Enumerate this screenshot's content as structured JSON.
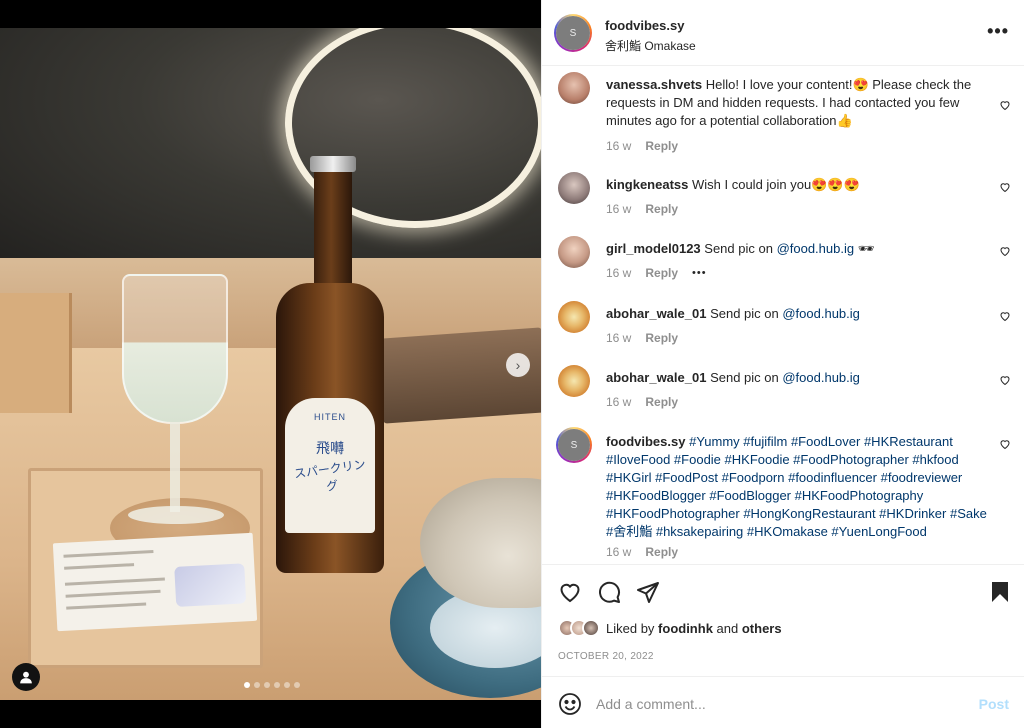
{
  "post": {
    "username": "foodvibes.sy",
    "location": "舍利鮨 Omakase",
    "avatar_text": "S"
  },
  "media": {
    "label_brand": "HITEN",
    "label_line1": "飛囀",
    "label_line2": "スパークリング",
    "carousel": {
      "count": 6,
      "active_index": 0
    }
  },
  "comments": [
    {
      "username": "vanessa.shvets",
      "text": "Hello! I love your content!😍 Please check the requests in DM and hidden requests. I had contacted you few minutes ago for a potential collaboration👍",
      "time": "16 w",
      "reply": "Reply"
    },
    {
      "username": "kingkeneatss",
      "text": "Wish I could join you😍😍😍",
      "time": "16 w",
      "reply": "Reply"
    },
    {
      "username": "girl_model0123",
      "text_before": "Send pic on ",
      "mention": "@food.hub.ig",
      "text_after": " 🕶",
      "time": "16 w",
      "reply": "Reply",
      "more": "•••"
    },
    {
      "username": "abohar_wale_01",
      "text_before": "Send pic on ",
      "mention": "@food.hub.ig",
      "time": "16 w",
      "reply": "Reply"
    },
    {
      "username": "abohar_wale_01",
      "text_before": "Send pic on ",
      "mention": "@food.hub.ig",
      "time": "16 w",
      "reply": "Reply"
    },
    {
      "username": "foodvibes.sy",
      "hashtags": "#Yummy #fujifilm #FoodLover #HKRestaurant #IloveFood #Foodie #HKFoodie #FoodPhotographer #hkfood #HKGirl #FoodPost #Foodporn #foodinfluencer #foodreviewer #HKFoodBlogger #FoodBlogger #HKFoodPhotography #HKFoodPhotographer #HongKongRestaurant #HKDrinker #Sake #舍利鮨 #hksakepairing #HKOmakase #YuenLongFood",
      "time": "16 w",
      "reply": "Reply"
    }
  ],
  "likes": {
    "prefix": "Liked by ",
    "user": "foodinhk",
    "middle": " and ",
    "others": "others"
  },
  "date": "OCTOBER 20, 2022",
  "add_comment": {
    "placeholder": "Add a comment...",
    "post_label": "Post"
  },
  "icons": {
    "like": "heart-icon",
    "comment": "comment-icon",
    "share": "share-icon",
    "save": "bookmark-icon",
    "emoji": "emoji-icon",
    "more": "more-icon",
    "next": "chevron-right-icon",
    "tag": "user-tag-icon"
  },
  "colors": {
    "link": "#00376b",
    "muted": "#8e8e8e",
    "post_disabled": "#b2dffc"
  }
}
